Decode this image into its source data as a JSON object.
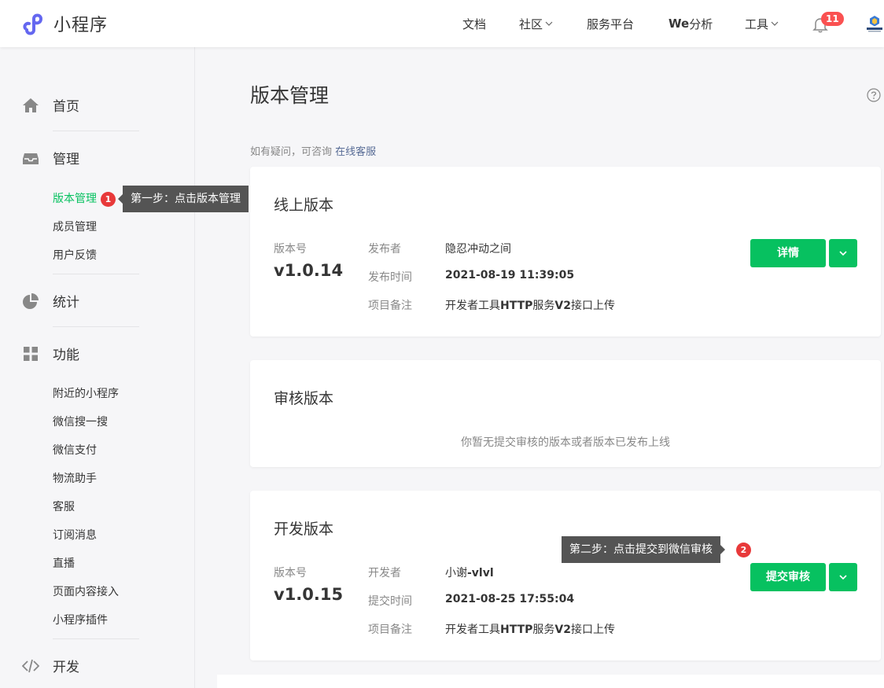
{
  "header": {
    "logo_text": "小程序",
    "nav": [
      "文档",
      "社区",
      "服务平台",
      "We",
      "分析",
      "工具"
    ],
    "notification_count": "11",
    "colors": {
      "accent": "#07c160",
      "logo": "#6467f0",
      "badge": "#fa5151"
    }
  },
  "sidebar": {
    "home": "首页",
    "manage": "管理",
    "manage_items": [
      "版本管理",
      "成员管理",
      "用户反馈"
    ],
    "stats": "统计",
    "features": "功能",
    "feature_items": [
      "附近的小程序",
      "微信搜一搜",
      "微信支付",
      "物流助手",
      "客服",
      "订阅消息",
      "直播",
      "页面内容接入",
      "小程序插件"
    ],
    "dev": "开发"
  },
  "step1": {
    "number": "1",
    "text": "第一步：点击版本管理"
  },
  "step2": {
    "number": "2",
    "text": "第二步：点击提交到微信审核"
  },
  "main": {
    "title": "版本管理",
    "hint_prefix": "如有疑问，可咨询",
    "hint_link": "在线客服",
    "online": {
      "title": "线上版本",
      "version_label": "版本号",
      "version": "v1.0.14",
      "publisher_label": "发布者",
      "publisher": "隐忍冲动之间",
      "time_label": "发布时间",
      "time": "2021-08-19 11:39:05",
      "note_label": "项目备注",
      "note_a": "开发者工具",
      "note_b": "HTTP",
      "note_c": "服务",
      "note_d": "V2",
      "note_e": "接口上传",
      "detail_button": "详情"
    },
    "review": {
      "title": "审核版本",
      "empty": "你暂无提交审核的版本或者版本已发布上线"
    },
    "dev": {
      "title": "开发版本",
      "version_label": "版本号",
      "version": "v1.0.15",
      "developer_label": "开发者",
      "developer_a": "小谢",
      "developer_b": "-vlvl",
      "time_label": "提交时间",
      "time": "2021-08-25 17:55:04",
      "note_label": "项目备注",
      "note_a": "开发者工具",
      "note_b": "HTTP",
      "note_c": "服务",
      "note_d": "V2",
      "note_e": "接口上传",
      "submit_button": "提交审核"
    }
  }
}
